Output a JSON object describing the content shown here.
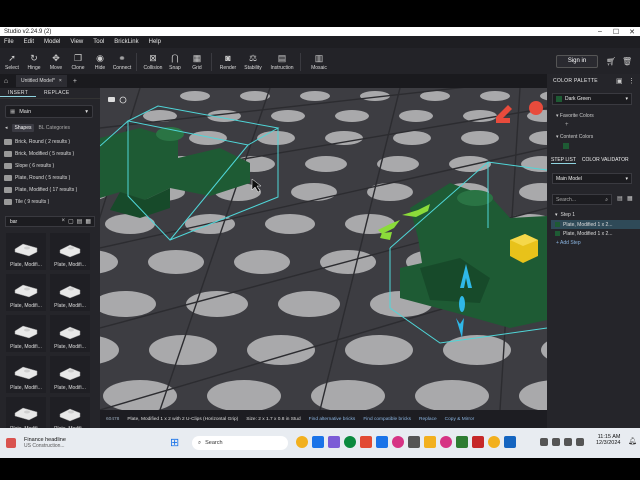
{
  "window": {
    "title": "Studio v2.24.9 (2)",
    "controls": [
      "–",
      "☐",
      "✕"
    ]
  },
  "menu": [
    "File",
    "Edit",
    "Model",
    "View",
    "Tool",
    "BrickLink",
    "Help"
  ],
  "toolbar": {
    "tools": [
      "Select",
      "Hinge",
      "Move",
      "Clone",
      "Hide",
      "Connect"
    ],
    "tools2": [
      "Collision",
      "Snap",
      "Grid"
    ],
    "tools3": [
      "Render",
      "Stability",
      "Instruction"
    ],
    "tools4": [
      "Mosaic"
    ],
    "sign_in": "Sign in"
  },
  "tabs": {
    "active_tab": "Untitled Model*"
  },
  "left_panel": {
    "tabs": [
      "INSERT",
      "REPLACE"
    ],
    "library_select": "Main",
    "shapes_chip": "Shapes",
    "all_categories": "BL Categories",
    "shape_list": [
      "Brick, Round ( 2 results )",
      "Brick, Modified ( 5 results )",
      "Slope ( 6 results )",
      "Plate, Round ( 5 results )",
      "Plate, Modified ( 17 results )",
      "Tile ( 9 results )"
    ],
    "search_value": "bar",
    "parts": [
      "Plate, Modifi...",
      "Plate, Modifi...",
      "Plate, Modifi...",
      "Plate, Modifi...",
      "Plate, Modifi...",
      "Plate, Modifi...",
      "Plate, Modifi...",
      "Plate, Modifi...",
      "Plate, Modifi...",
      "Plate, Modifi..."
    ]
  },
  "status": {
    "part_id": "60478",
    "description": "Plate, Modified 1 x 2 with 2 U-Clips (Horizontal Grip)",
    "size": "Size: 2 x 1.7 x 0.8 in Stud",
    "links": [
      "Find alternative bricks",
      "Find compatible bricks",
      "Replace",
      "Copy & Mirror"
    ]
  },
  "right_panel": {
    "color_palette_title": "COLOR PALETTE",
    "selected_color": "Dark Green",
    "favorite_colors": "Favorite Colors",
    "content_colors": "Content Colors",
    "step_tabs": [
      "STEP LIST",
      "COLOR VALIDATOR"
    ],
    "model_select": "Main Model",
    "search_placeholder": "Search...",
    "step_label": "Step 1",
    "steps": [
      "Plate, Modified 1 x 2...",
      "Plate, Modified 1 x 2..."
    ],
    "add_step": "+ Add Step"
  },
  "taskbar": {
    "weather_title": "Finance headline",
    "weather_sub": "US Construction...",
    "search_placeholder": "Search",
    "time": "11:15 AM",
    "date": "12/3/2024"
  },
  "colors": {
    "brick": "#1e5b34",
    "accent": "#4fd6d8",
    "viewport": "#3d3d42",
    "stud": "#a9a9ab"
  }
}
